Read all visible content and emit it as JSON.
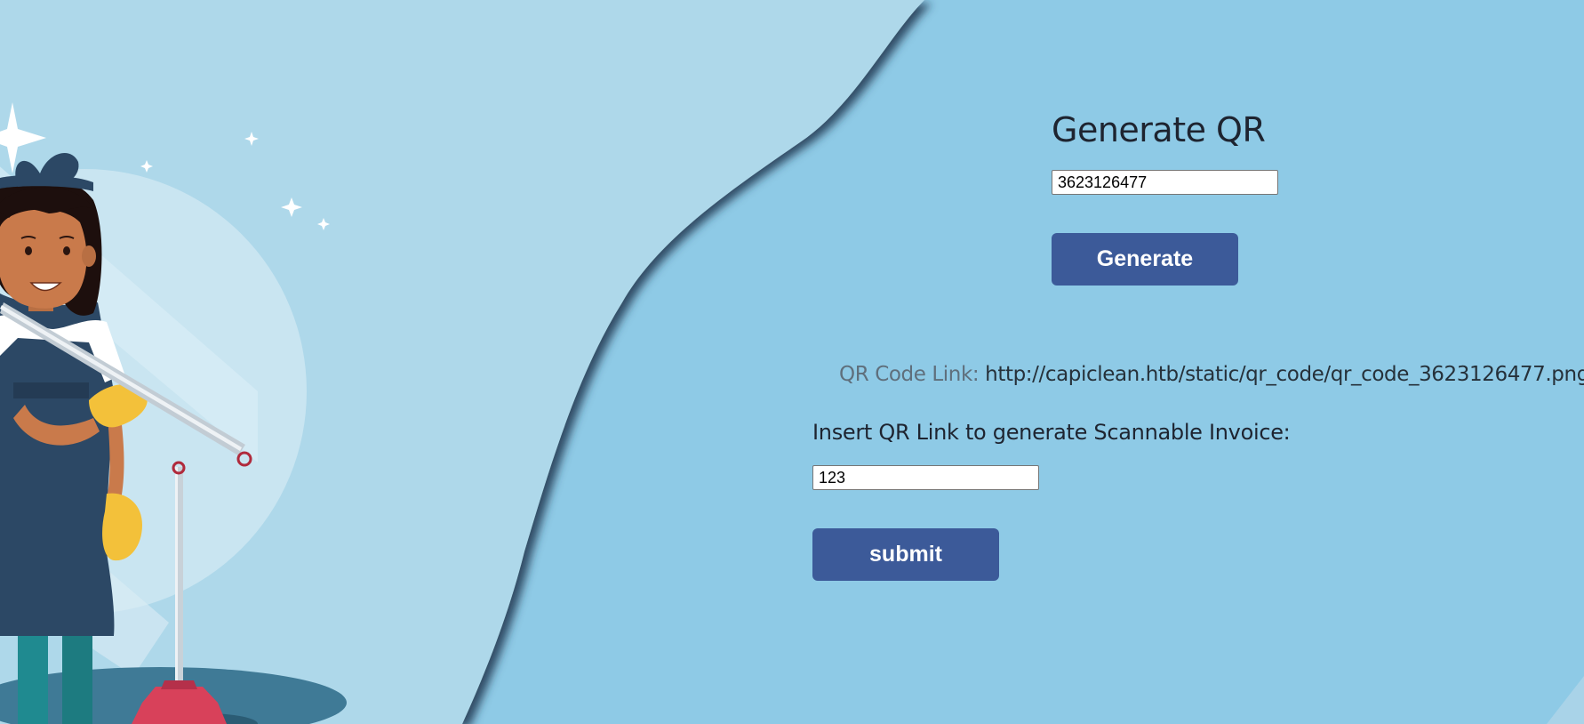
{
  "generate_form": {
    "title": "Generate QR",
    "input_value": "3623126477",
    "button_label": "Generate"
  },
  "qr_result": {
    "label": "QR Code Link:",
    "url": "http://capiclean.htb/static/qr_code/qr_code_3623126477.png"
  },
  "invoice_form": {
    "label": "Insert QR Link to generate Scannable Invoice:",
    "input_value": "123",
    "button_label": "submit"
  },
  "colors": {
    "background_right": "#8ecae6",
    "background_left": "#add8ea",
    "button": "#3c5a99"
  },
  "illustration": "cleaning-lady-with-mop"
}
